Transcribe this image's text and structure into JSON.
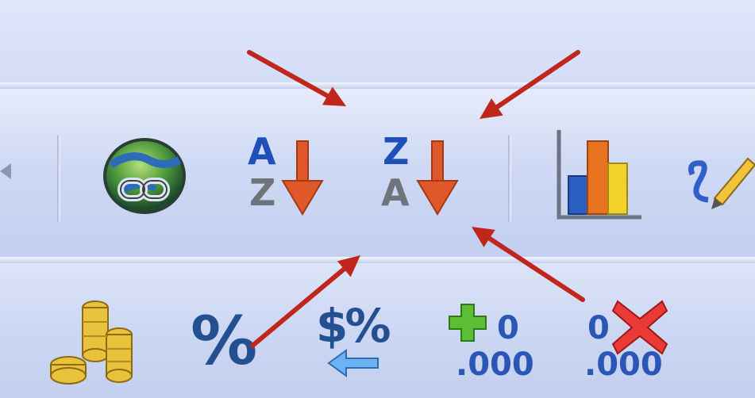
{
  "toolbar_top": {
    "buttons": [
      {
        "name": "chevron-left-icon"
      },
      {
        "name": "hyperlink-globe-icon"
      },
      {
        "name": "sort-ascending-icon",
        "letter_top": "A",
        "letter_bottom": "Z"
      },
      {
        "name": "sort-descending-icon",
        "letter_top": "Z",
        "letter_bottom": "A"
      },
      {
        "name": "chart-wizard-icon"
      },
      {
        "name": "drawing-pencil-icon"
      }
    ]
  },
  "toolbar_bottom": {
    "buttons": [
      {
        "name": "coins-currency-icon"
      },
      {
        "name": "percent-style-icon",
        "label": "%"
      },
      {
        "name": "euro-conversion-icon",
        "label_symbols": "$%"
      },
      {
        "name": "increase-decimal-icon",
        "digit": "0",
        "decimals": ".000"
      },
      {
        "name": "decrease-decimal-icon",
        "digit": "0",
        "decimals": ".000"
      }
    ]
  },
  "annotation": {
    "arrow_color": "#c0261b",
    "arrow_count": 4
  },
  "colors": {
    "toolbar_bg": "#cbd6f2",
    "sort_letter_blue": "#1f4fb8",
    "sort_letter_gray": "#6f737a",
    "sort_arrow_orange": "#e0582a",
    "decimal_plus_green": "#4caf2a",
    "decimal_x_red": "#e3242b"
  }
}
